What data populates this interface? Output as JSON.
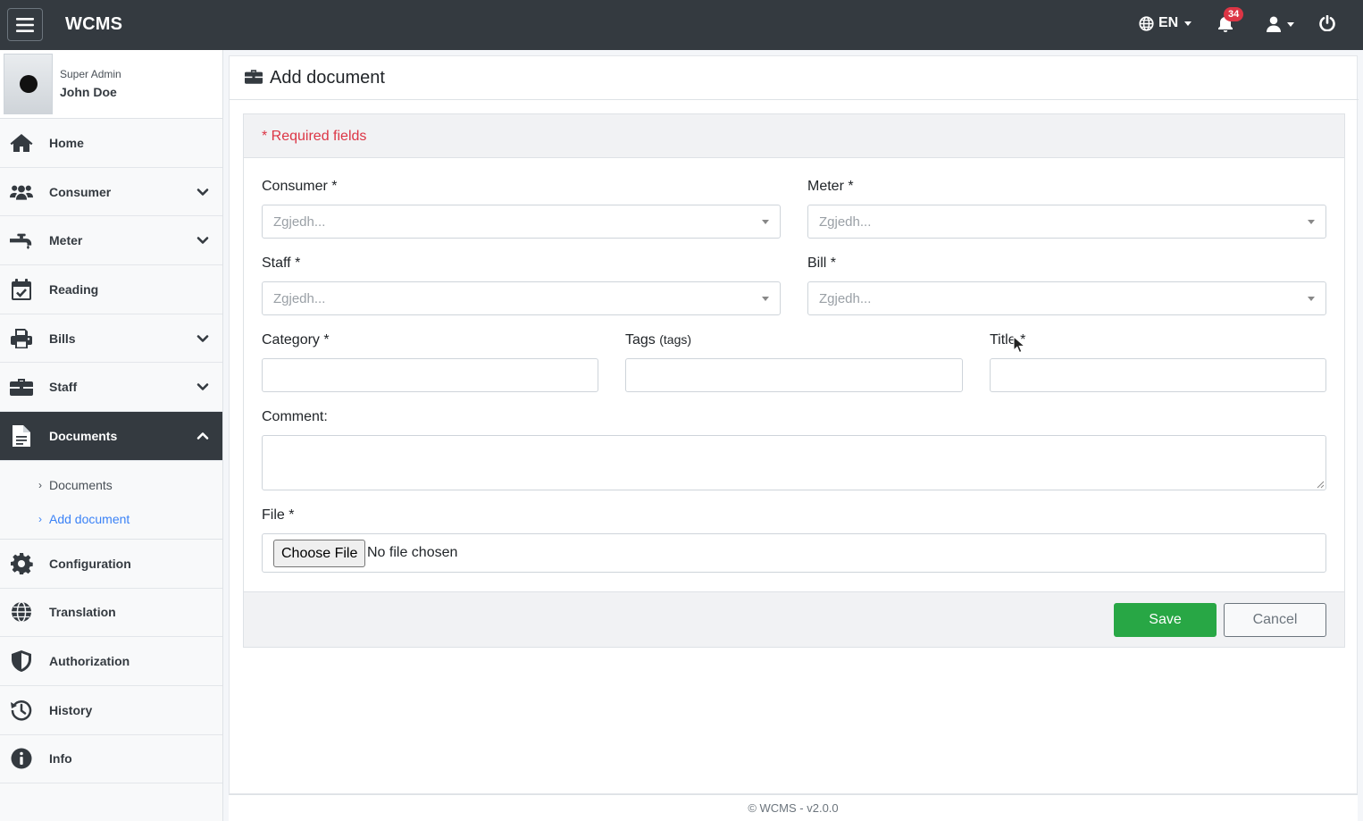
{
  "app": {
    "brand": "WCMS"
  },
  "topbar": {
    "language": "EN",
    "notifications_count": "34"
  },
  "user": {
    "role": "Super Admin",
    "name": "John Doe"
  },
  "sidebar": {
    "items": [
      {
        "label": "Home",
        "icon": "home-icon"
      },
      {
        "label": "Consumer",
        "icon": "users-icon"
      },
      {
        "label": "Meter",
        "icon": "faucet-icon"
      },
      {
        "label": "Reading",
        "icon": "calendar-check-icon"
      },
      {
        "label": "Bills",
        "icon": "printer-icon"
      },
      {
        "label": "Staff",
        "icon": "briefcase-icon"
      },
      {
        "label": "Documents",
        "icon": "file-icon"
      },
      {
        "label": "Configuration",
        "icon": "gear-icon"
      },
      {
        "label": "Translation",
        "icon": "globe-icon"
      },
      {
        "label": "Authorization",
        "icon": "shield-icon"
      },
      {
        "label": "History",
        "icon": "history-icon"
      },
      {
        "label": "Info",
        "icon": "info-icon"
      }
    ],
    "documents_sub": [
      {
        "label": "Documents"
      },
      {
        "label": "Add document"
      }
    ]
  },
  "page": {
    "title": "Add document"
  },
  "form": {
    "required_note": "* Required fields",
    "consumer_label": "Consumer *",
    "meter_label": "Meter *",
    "staff_label": "Staff *",
    "bill_label": "Bill *",
    "select_placeholder": "Zgjedh...",
    "category_label": "Category *",
    "tags_label": "Tags",
    "tags_hint": "(tags)",
    "title_label": "Title *",
    "comment_label": "Comment:",
    "file_label": "File *",
    "choose_file": "Choose File",
    "no_file": "No file chosen",
    "save": "Save",
    "cancel": "Cancel"
  },
  "footer": {
    "text": "© WCMS - v2.0.0"
  }
}
